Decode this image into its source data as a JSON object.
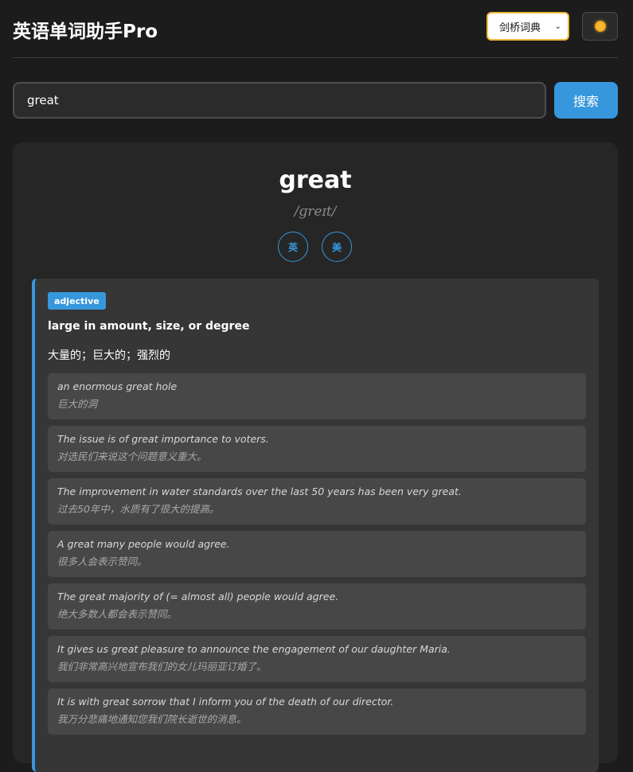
{
  "header": {
    "title": "英语单词助手Pro",
    "dictionary_selected": "剑桥词典",
    "theme_icon": "sun-icon"
  },
  "search": {
    "value": "great",
    "button_label": "搜索"
  },
  "entry": {
    "word": "great",
    "phonetic": "/ɡreɪt/",
    "pron_uk_label": "英",
    "pron_us_label": "美",
    "meanings": [
      {
        "pos": "adjective",
        "definition_en": "large in amount, size, or degree",
        "definition_zh": "大量的；巨大的；强烈的",
        "examples": [
          {
            "en": "an enormous great hole",
            "zh": "巨大的洞"
          },
          {
            "en": "The issue is of great importance to voters.",
            "zh": "对选民们来说这个问题意义重大。"
          },
          {
            "en": "The improvement in water standards over the last 50 years has been very great.",
            "zh": "过去50年中，水质有了很大的提高。"
          },
          {
            "en": "A great many people would agree.",
            "zh": "很多人会表示赞同。"
          },
          {
            "en": "The great majority of (= almost all) people would agree.",
            "zh": "绝大多数人都会表示赞同。"
          },
          {
            "en": "It gives us great pleasure to announce the engagement of our daughter Maria.",
            "zh": "我们非常高兴地宣布我们的女儿玛丽亚订婚了。"
          },
          {
            "en": "It is with great sorrow that I inform you of the death of our director.",
            "zh": "我万分悲痛地通知您我们院长逝世的消息。"
          }
        ]
      }
    ]
  },
  "colors": {
    "accent": "#3797dc",
    "background": "#1c1c1c",
    "card": "#262626",
    "select_border": "#f0b93a"
  }
}
